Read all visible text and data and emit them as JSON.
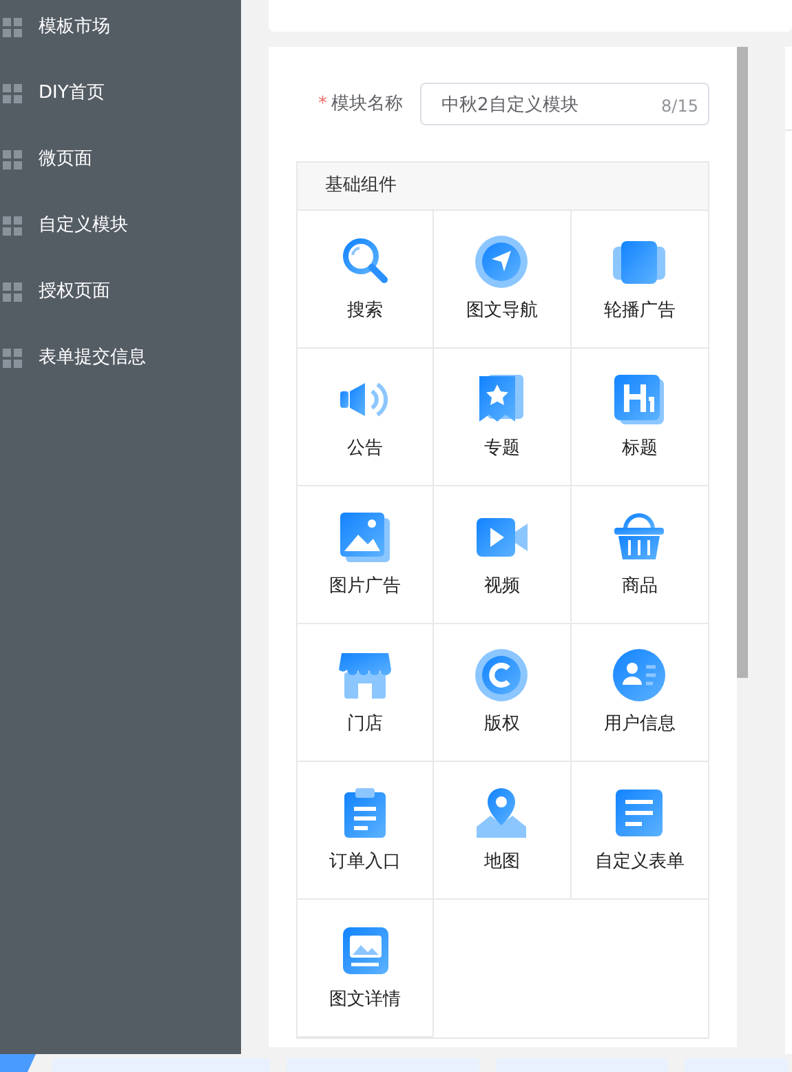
{
  "sidebar": {
    "items": [
      {
        "label": "模板市场",
        "selected": false
      },
      {
        "label": "DIY首页",
        "selected": false
      },
      {
        "label": "微页面",
        "selected": false
      },
      {
        "label": "自定义模块",
        "selected": false
      },
      {
        "label": "授权页面",
        "selected": false
      },
      {
        "label": "表单提交信息",
        "selected": false
      }
    ]
  },
  "form": {
    "name_field": {
      "label": "模块名称",
      "required_mark": "*",
      "value": "中秋2自定义模块",
      "counter": "8/15"
    }
  },
  "components": {
    "title": "基础组件",
    "items": [
      {
        "label": "搜索"
      },
      {
        "label": "图文导航"
      },
      {
        "label": "轮播广告"
      },
      {
        "label": "公告"
      },
      {
        "label": "专题"
      },
      {
        "label": "标题"
      },
      {
        "label": "图片广告"
      },
      {
        "label": "视频"
      },
      {
        "label": "商品"
      },
      {
        "label": "门店"
      },
      {
        "label": "版权"
      },
      {
        "label": "用户信息"
      },
      {
        "label": "订单入口"
      },
      {
        "label": "地图"
      },
      {
        "label": "自定义表单"
      },
      {
        "label": "图文详情"
      }
    ]
  }
}
